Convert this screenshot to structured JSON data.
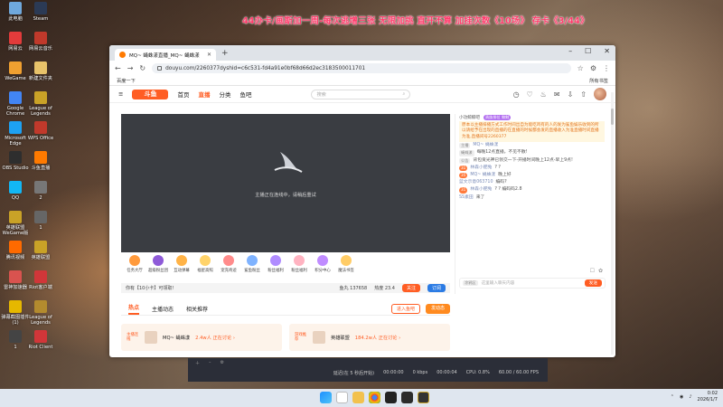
{
  "banner": "44办卡/画斯加一周-每次逃增三张 无限加挑 直开不算 加挂次数《10场》 存卡《3/44》",
  "desktop_icons": [
    {
      "label": "此电脑"
    },
    {
      "label": "Steam"
    },
    {
      "label": "网易云"
    },
    {
      "label": "网易云音乐"
    },
    {
      "label": "WeGame"
    },
    {
      "label": "新建文件夹"
    },
    {
      "label": "Google Chrome"
    },
    {
      "label": "League of Legends"
    },
    {
      "label": "Microsoft Edge"
    },
    {
      "label": "WPS Office"
    },
    {
      "label": "OBS Studio"
    },
    {
      "label": "斗鱼直播"
    },
    {
      "label": "QQ"
    },
    {
      "label": "2"
    },
    {
      "label": "英雄联盟WeGame版"
    },
    {
      "label": "1"
    },
    {
      "label": "腾讯视频"
    },
    {
      "label": "英雄联盟"
    },
    {
      "label": "雷神加速器"
    },
    {
      "label": "Riot客户端"
    },
    {
      "label": "弹幕截图插件(1)"
    },
    {
      "label": "League of Legends"
    },
    {
      "label": "1"
    },
    {
      "label": "Riot Client"
    }
  ],
  "browser": {
    "tab_title": "MQ~ 蝇蛛漾直播_MQ~ 蝇蛛漾",
    "url": "douyu.com/2260377dyshid=c6c531-fd4a91e0bf68d66d2ec3183500011701",
    "bookmarks_left": "百度一下",
    "bookmarks_right": "所有书签"
  },
  "site": {
    "logo": "斗鱼",
    "nav": [
      "首页",
      "直播",
      "分类",
      "鱼吧"
    ],
    "search_placeholder": "搜索"
  },
  "player": {
    "message": "主播正在连线中，请稍后重试"
  },
  "gifts": [
    "任务大厅",
    "超级粉丝团",
    "互动弹幕",
    "福星高照",
    "宠充奇迹",
    "鲨鱼粉丝",
    "粉丝福利",
    "粉丝福利",
    "积分中心",
    "魔法书签"
  ],
  "infobar": {
    "left": "你有【10小卡】可领取!",
    "fans": "鱼丸 137658",
    "score": "热度 23.4",
    "btn1": "关注",
    "btn2": "订阅"
  },
  "tabs": [
    "热点",
    "主播动态",
    "相关推荐"
  ],
  "tab_buttons": [
    "进入鱼吧",
    "发动态"
  ],
  "recommend": [
    {
      "tag": "主播连线",
      "name": "MQ~ 蝇蛛漾",
      "status": "2.4w人 正在讨论 ›"
    },
    {
      "tag": "游戏推荐",
      "name": "英雄联盟",
      "status": "184.2w人 正在讨论 ›"
    }
  ],
  "chat": {
    "top_user": "小功鲸鲸吧",
    "top_badge": "贵族排位 鲸鲸",
    "notice": "原本以主播排播方式工作时间出自为能吃鸡有的人的发为鲨鱼娱乐收到的所以请给予在出现的直播的在直播的时候都会发的直播收入为准直播时间直播为准,直播间号2260377",
    "lines": [
      {
        "badge": "主播",
        "name": "MQ~ 蝇蛛漾",
        "text": ""
      },
      {
        "badge": "蝇蛛漾",
        "name": "",
        "text": "每晚12点直播，不见不散!"
      },
      {
        "badge": "公告",
        "name": "",
        "text": "背包贡光神已领交一下-开播时间晚上12点-早上9点!"
      },
      {
        "lvl": "31",
        "name": "林森小肥兔",
        "text": "? ?"
      },
      {
        "lvl": "35",
        "name": "MQ~ 蝇蛛漾",
        "text": "晚上好"
      },
      {
        "lvl": "",
        "name": "蓝文示意063710",
        "text": "编码?"
      },
      {
        "lvl": "31",
        "name": "林森小肥兔",
        "text": "? ? 编码码2.8"
      },
      {
        "lvl": "",
        "name": "SS素田",
        "text": "来了"
      }
    ],
    "input_placeholder": "这里输入聊天内容",
    "send": "发送",
    "input_badge": "涂鸦区"
  },
  "obs": {
    "status_left": "延迟(在 5 秒后开始)",
    "time1": "00:00:00",
    "kbps": "0 kbps",
    "time2": "00:00:04",
    "cpu": "CPU: 0.8%",
    "fps": "60.00 / 60.00 FPS"
  },
  "taskbar": {
    "time": "0:02",
    "date": "2026/1/7"
  },
  "colors": {
    "accent": "#ff5d23",
    "banner": "#ff3b6b"
  }
}
